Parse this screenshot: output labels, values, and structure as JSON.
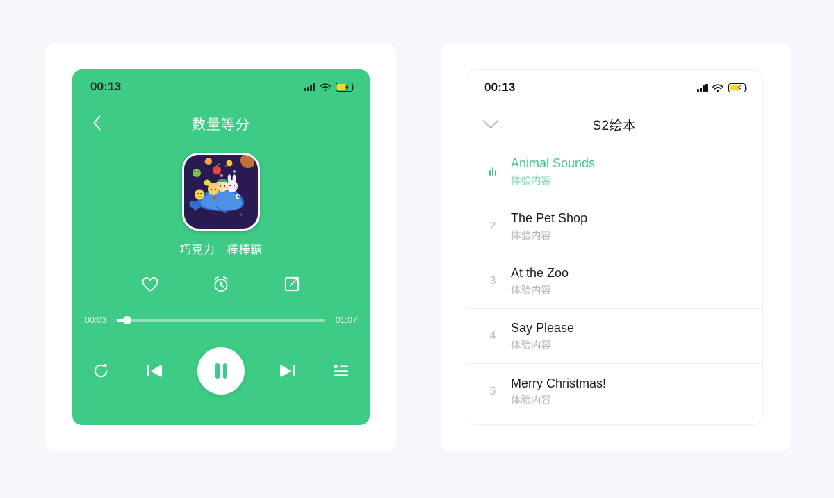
{
  "theme": {
    "page_background": "#f5f7fa",
    "accent_green": "#3ecb85",
    "battery_yellow": "#ffd426",
    "card_white": "#ffffff"
  },
  "player": {
    "status_bar": {
      "time": "00:13",
      "signal_icon": "cellular-signal-icon",
      "wifi_icon": "wifi-icon",
      "battery_icon": "battery-charging-icon"
    },
    "nav": {
      "back_icon": "chevron-left-icon",
      "title": "数量等分"
    },
    "album": {
      "art_name": "album-art-whale",
      "track_name": "巧克力　棒棒糖"
    },
    "actions": [
      {
        "name": "favorite-button",
        "icon": "heart-icon"
      },
      {
        "name": "timer-button",
        "icon": "alarm-clock-icon"
      },
      {
        "name": "share-button",
        "icon": "share-icon"
      }
    ],
    "progress": {
      "elapsed": "00:03",
      "duration": "01:07",
      "percent": 5
    },
    "transport": {
      "repeat_icon": "repeat-icon",
      "previous_icon": "previous-track-icon",
      "play_state_icon": "pause-icon",
      "next_icon": "next-track-icon",
      "playlist_icon": "playlist-icon"
    }
  },
  "playlist": {
    "status_bar": {
      "time": "00:13",
      "signal_icon": "cellular-signal-icon",
      "wifi_icon": "wifi-icon",
      "battery_icon": "battery-charging-icon"
    },
    "nav": {
      "collapse_icon": "chevron-down-icon",
      "title": "S2绘本"
    },
    "tracks": [
      {
        "index": "",
        "title": "Animal Sounds",
        "subtitle": "体验内容",
        "playing": true
      },
      {
        "index": "2",
        "title": "The Pet Shop",
        "subtitle": "体验内容",
        "playing": false
      },
      {
        "index": "3",
        "title": "At the Zoo",
        "subtitle": "体验内容",
        "playing": false
      },
      {
        "index": "4",
        "title": "Say Please",
        "subtitle": "体验内容",
        "playing": false
      },
      {
        "index": "5",
        "title": "Merry Christmas!",
        "subtitle": "体验内容",
        "playing": false
      }
    ]
  }
}
